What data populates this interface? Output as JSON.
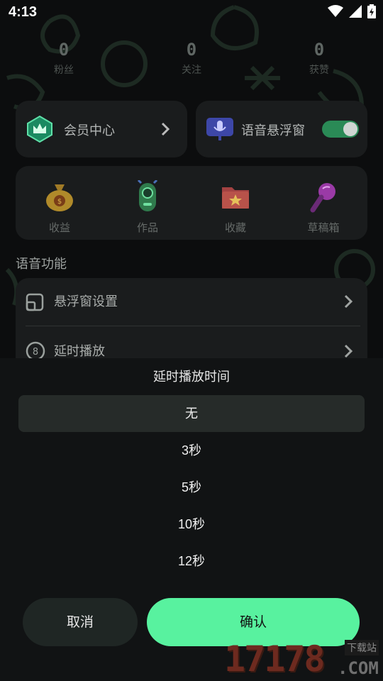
{
  "status_bar": {
    "time": "4:13"
  },
  "stats": [
    {
      "value": "0",
      "label": "粉丝"
    },
    {
      "value": "0",
      "label": "关注"
    },
    {
      "value": "0",
      "label": "获赞"
    }
  ],
  "member_card": {
    "label": "会员中心"
  },
  "voice_float_card": {
    "label": "语音悬浮窗",
    "toggle_on": true
  },
  "grid": [
    {
      "label": "收益",
      "icon": "money-bag-icon"
    },
    {
      "label": "作品",
      "icon": "robot-mic-icon"
    },
    {
      "label": "收藏",
      "icon": "star-folder-icon"
    },
    {
      "label": "草稿箱",
      "icon": "microphone-icon"
    }
  ],
  "section": {
    "title": "语音功能"
  },
  "list": [
    {
      "label": "悬浮窗设置",
      "icon": "window-icon"
    },
    {
      "label": "延时播放",
      "icon": "timer-icon"
    }
  ],
  "sheet": {
    "title": "延时播放时间",
    "options": [
      "无",
      "3秒",
      "5秒",
      "10秒",
      "12秒"
    ],
    "selected_index": 0,
    "cancel_label": "取消",
    "confirm_label": "确认"
  },
  "watermark": {
    "number": "17178",
    "tag": "下载站",
    "suffix": ".COM"
  },
  "colors": {
    "accent": "#58f29f",
    "background": "#0c0d0e",
    "sheet": "#111314"
  }
}
